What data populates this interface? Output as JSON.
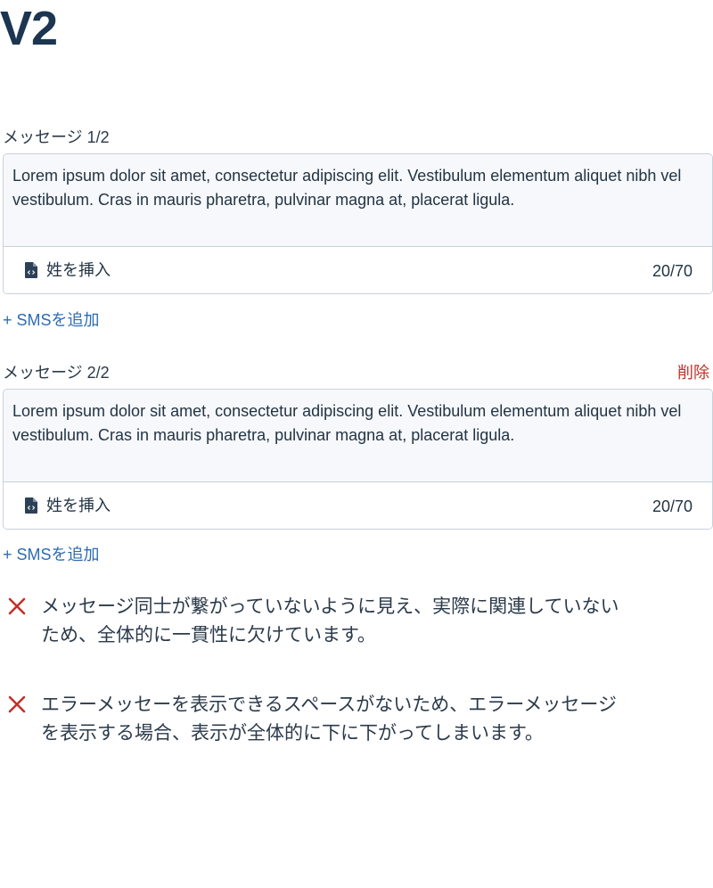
{
  "page": {
    "title": "V2"
  },
  "messages": [
    {
      "label": "メッセージ 1/2",
      "body": "Lorem ipsum dolor sit amet, consectetur adipiscing elit. Vestibulum elementum aliquet nibh vel vestibulum. Cras in mauris pharetra, pulvinar magna at, placerat ligula.",
      "insert_label": "姓を挿入",
      "counter": "20/70",
      "add_label": "+ SMSを追加"
    },
    {
      "label": "メッセージ 2/2",
      "delete_label": "削除",
      "body": "Lorem ipsum dolor sit amet, consectetur adipiscing elit. Vestibulum elementum aliquet nibh vel vestibulum. Cras in mauris pharetra, pulvinar magna at, placerat ligula.",
      "insert_label": "姓を挿入",
      "counter": "20/70",
      "add_label": "+ SMSを追加"
    }
  ],
  "notes": [
    {
      "icon": "x-icon",
      "text": "メッセージ同士が繋がっていないように見え、実際に関連していないため、全体的に一貫性に欠けています。"
    },
    {
      "icon": "x-icon",
      "text": "エラーメッセーを表示できるスペースがないため、エラーメッセージを表示する場合、表示が全体的に下に下がってしまいます。"
    }
  ],
  "colors": {
    "title": "#1c3550",
    "link": "#2d6cb0",
    "danger": "#c0312b",
    "border": "#c8d1db",
    "textarea_bg": "#f6f8fb"
  }
}
